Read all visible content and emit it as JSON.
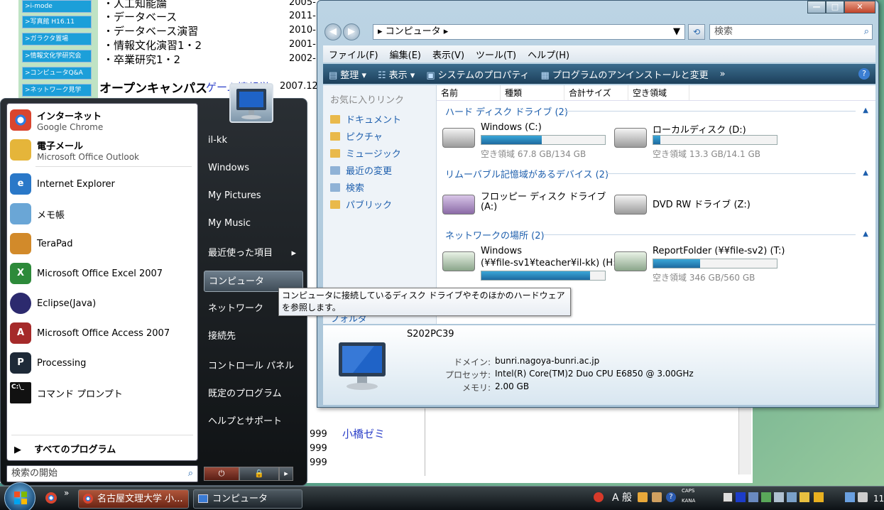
{
  "background_page": {
    "nav_links": [
      ">i-mode",
      ">写真館 H16.11",
      ">ガラクタ置場",
      ">情報文化学研究会",
      ">コンピュータQ&A",
      ">ネットワーク見学"
    ],
    "courses": [
      {
        "label": "・人工知能論",
        "year": "2005-"
      },
      {
        "label": "・データベース",
        "year": "2011-"
      },
      {
        "label": "・データベース演習",
        "year": "2010-"
      },
      {
        "label": "・情報文化演習1・2",
        "year": "2001-"
      },
      {
        "label": "・卒業研究1・2",
        "year": "2002-"
      }
    ],
    "open_campus": "オープンキャンパス",
    "game": "ゲーム情報学",
    "game_year": "2007.12",
    "years_lower": [
      "999",
      "999",
      "999"
    ],
    "seminar": "小橋ゼミ"
  },
  "explorer": {
    "window_controls": {
      "minimize": "—",
      "maximize": "□",
      "close": "✕"
    },
    "address": "▸ コンピュータ ▸",
    "search_placeholder": "検索",
    "menus": [
      "ファイル(F)",
      "編集(E)",
      "表示(V)",
      "ツール(T)",
      "ヘルプ(H)"
    ],
    "toolbar": {
      "organize": "整理",
      "view": "表示",
      "properties": "システムのプロパティ",
      "uninstall": "プログラムのアンインストールと変更",
      "more": "»"
    },
    "favorites_header": "お気に入りリンク",
    "favorites": [
      "ドキュメント",
      "ピクチャ",
      "ミュージック",
      "最近の変更",
      "検索",
      "パブリック"
    ],
    "folders_label": "フォルダ",
    "columns": [
      "名前",
      "種類",
      "合計サイズ",
      "空き領域"
    ],
    "groups": [
      {
        "title": "ハード ディスク ドライブ (2)"
      },
      {
        "title": "リムーバブル記憶域があるデバイス (2)"
      },
      {
        "title": "ネットワークの場所 (2)"
      }
    ],
    "drives": {
      "c": {
        "name": "Windows (C:)",
        "free": "空き領域 67.8 GB/134 GB",
        "used_fraction": 0.49
      },
      "d": {
        "name": "ローカルディスク (D:)",
        "free": "空き領域 13.3 GB/14.1 GB",
        "used_fraction": 0.06
      },
      "a": {
        "name_line1": "フロッピー ディスク ドライブ",
        "name_line2": "(A:)"
      },
      "z": {
        "name": "DVD RW ドライブ (Z:)"
      },
      "h": {
        "name_line1": "Windows",
        "name_line2": "(¥¥file-sv1¥teacher¥il-kk) (H:)",
        "used_fraction": 0.88
      },
      "t": {
        "name": "ReportFolder (¥¥file-sv2) (T:)",
        "free": "空き領域 346 GB/560 GB",
        "used_fraction": 0.38
      }
    },
    "details": {
      "pc_name": "S202PC39",
      "domain_label": "ドメイン:",
      "domain": "bunri.nagoya-bunri.ac.jp",
      "cpu_label": "プロセッサ:",
      "cpu": "Intel(R) Core(TM)2 Duo CPU     E6850  @ 3.00GHz",
      "mem_label": "メモリ:",
      "mem": "2.00 GB"
    }
  },
  "tooltip": {
    "line1": "コンピュータに接続しているディスク ドライブやそのほかのハードウェア",
    "line2": "を参照します。"
  },
  "start_menu": {
    "pinned": [
      {
        "name": "インターネット",
        "sub": "Google Chrome",
        "icon": "chrome-icon",
        "color": "#d9452f"
      },
      {
        "name": "電子メール",
        "sub": "Microsoft Office Outlook",
        "icon": "outlook-icon",
        "color": "#e5b53a"
      }
    ],
    "recent": [
      {
        "name": "Internet Explorer",
        "icon": "ie-icon",
        "color": "#2a78c8"
      },
      {
        "name": "メモ帳",
        "icon": "notepad-icon",
        "color": "#6aa6d6"
      },
      {
        "name": "TeraPad",
        "icon": "terapad-icon",
        "color": "#d28a2a"
      },
      {
        "name": "Microsoft Office Excel 2007",
        "icon": "excel-icon",
        "color": "#2d8a3a"
      },
      {
        "name": "Eclipse(Java)",
        "icon": "eclipse-icon",
        "color": "#2c2a6e"
      },
      {
        "name": "Microsoft Office Access 2007",
        "icon": "access-icon",
        "color": "#a52a2a"
      },
      {
        "name": "Processing",
        "icon": "processing-icon",
        "color": "#1e2a38"
      },
      {
        "name": "コマンド プロンプト",
        "icon": "cmd-icon",
        "color": "#111111"
      }
    ],
    "all_programs": "すべてのプログラム",
    "search_placeholder": "検索の開始",
    "right_items": [
      "il-kk",
      "Windows",
      "My Pictures",
      "My Music",
      "最近使った項目",
      "コンピュータ",
      "ネットワーク",
      "接続先",
      "コントロール パネル",
      "既定のプログラム",
      "ヘルプとサポート"
    ],
    "submenu_arrow": "▸",
    "power": {
      "power": "⏻",
      "lock": "🔒",
      "arrow": "▸"
    }
  },
  "taskbar": {
    "quick_chevron": "»",
    "buttons": [
      {
        "label": "名古屋文理大学 小...",
        "icon": "chrome-icon"
      },
      {
        "label": "コンピュータ",
        "icon": "computer-icon"
      }
    ],
    "ime": "A 般",
    "caps": "CAPS",
    "kana": "KANA",
    "clock": "11"
  }
}
